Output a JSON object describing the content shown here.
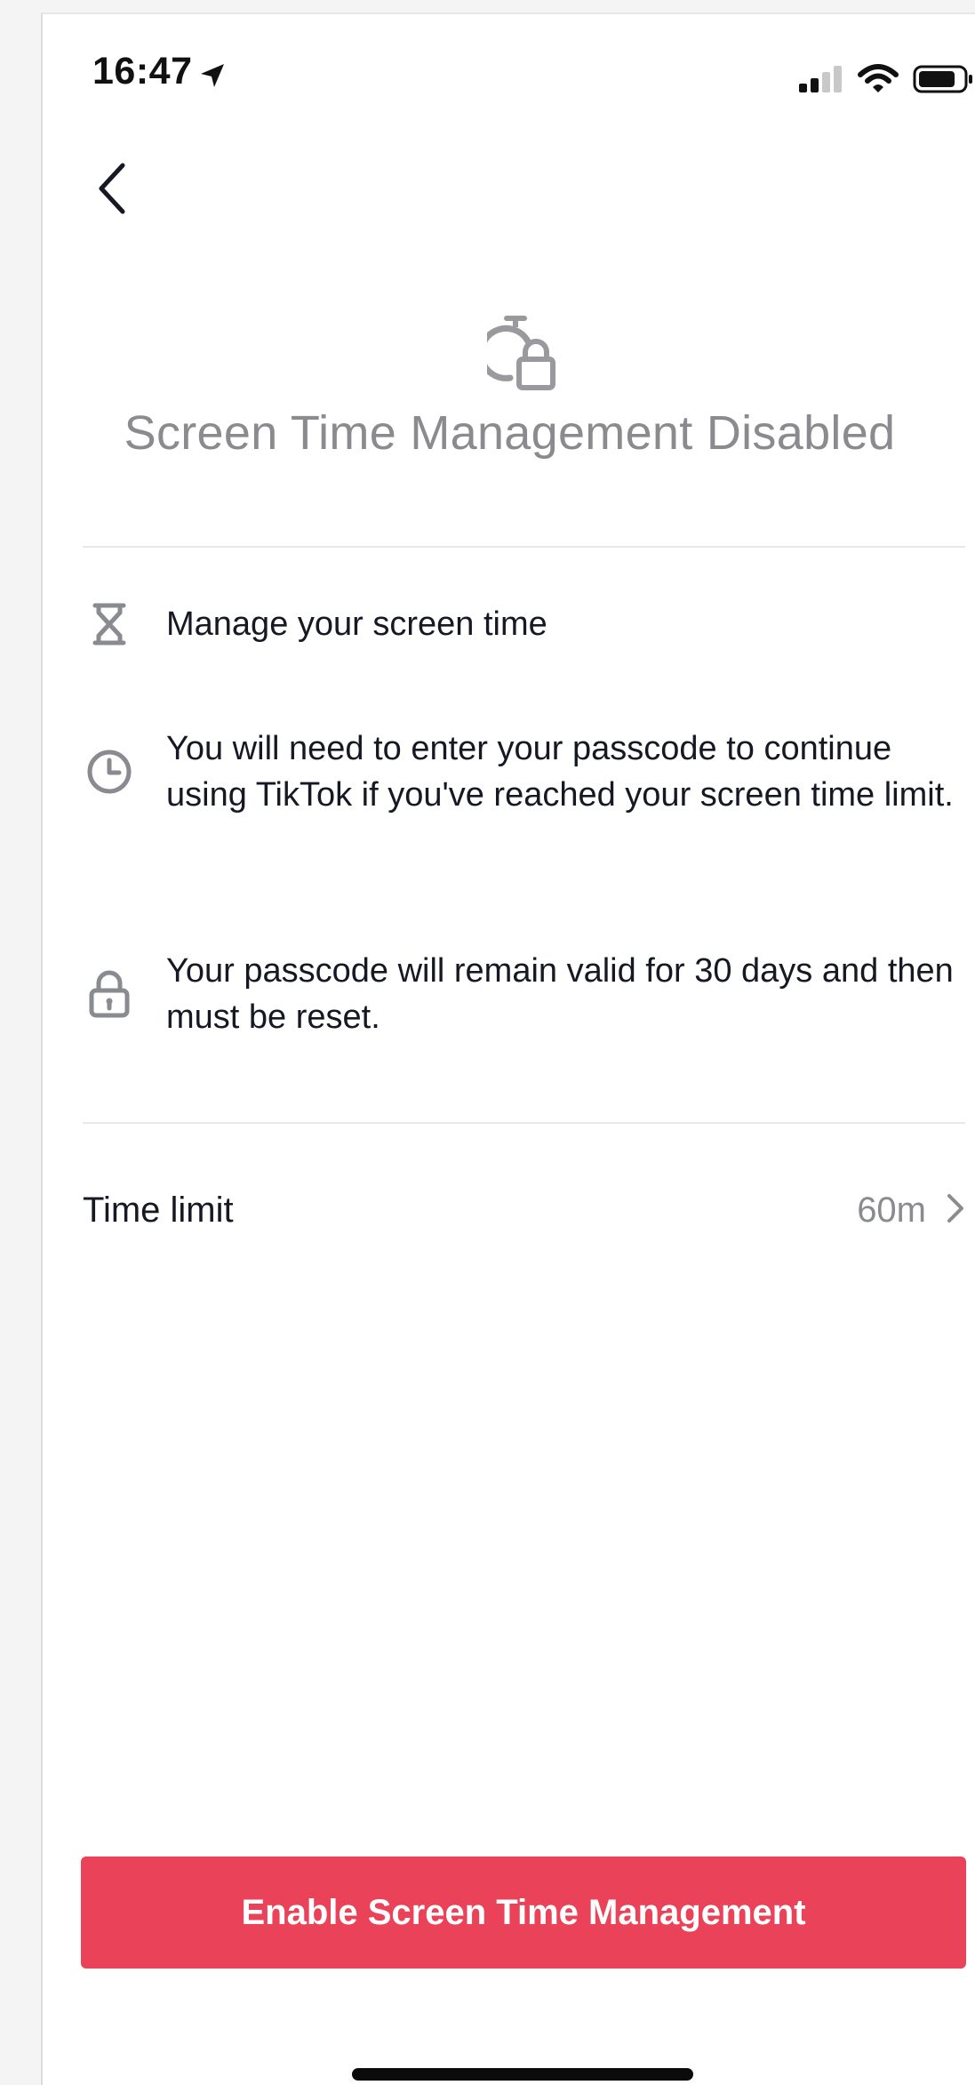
{
  "status_bar": {
    "time": "16:47",
    "icons": [
      "location-arrow-icon",
      "cellular-signal-icon",
      "wifi-icon",
      "battery-icon"
    ]
  },
  "nav": {
    "back_icon": "chevron-left-icon"
  },
  "header": {
    "icon": "stopwatch-lock-icon",
    "title": "Screen Time Management Disabled"
  },
  "info_items": [
    {
      "icon": "hourglass-icon",
      "text": "Manage your screen time"
    },
    {
      "icon": "clock-icon",
      "text": "You will need to enter your passcode to continue using TikTok if you've reached your screen time limit."
    },
    {
      "icon": "lock-icon",
      "text": "Your passcode will remain valid for 30 days and then must be reset."
    }
  ],
  "settings": {
    "time_limit": {
      "label": "Time limit",
      "value": "60m",
      "icon": "chevron-right-icon"
    }
  },
  "cta": {
    "label": "Enable Screen Time Management"
  },
  "colors": {
    "primary": "#EA4359",
    "text": "#161823",
    "muted": "#8A8B91",
    "divider": "#E8E8EA"
  }
}
